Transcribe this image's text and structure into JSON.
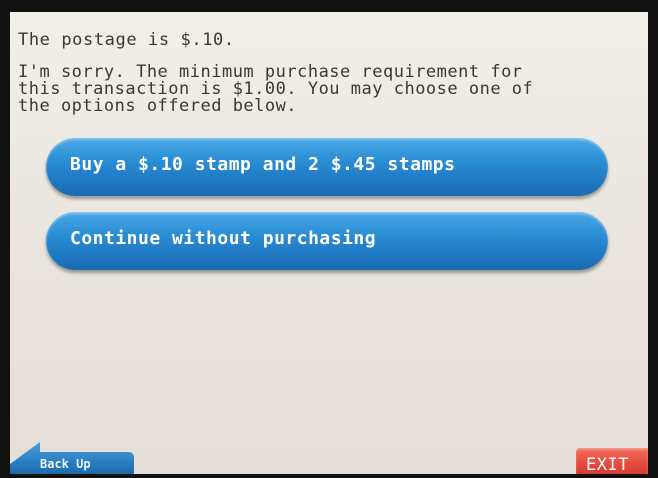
{
  "screen": {
    "postage_text": "The postage is $.10.",
    "message": "I'm sorry.  The minimum purchase requirement for\nthis transaction is $1.00.  You may choose one of\nthe options offered below."
  },
  "options": [
    {
      "label": "Buy a $.10 stamp and 2 $.45 stamps"
    },
    {
      "label": "Continue without purchasing"
    }
  ],
  "footer": {
    "back_label": "Back Up",
    "back_icon": "back-arrow-icon",
    "exit_label": "EXIT"
  },
  "colors": {
    "option_button": "#2a8dd3",
    "back_button": "#2b7fc4",
    "exit_button": "#e2473a",
    "background": "#eae6df"
  }
}
